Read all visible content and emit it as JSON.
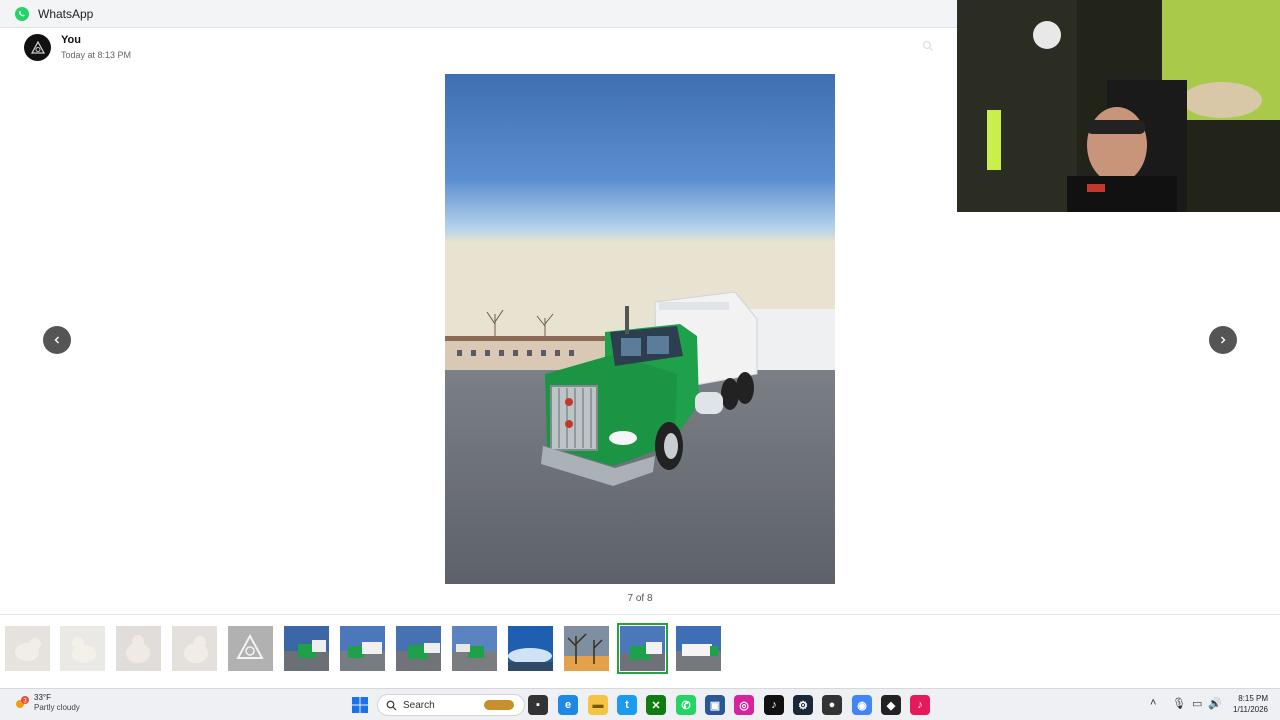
{
  "window": {
    "app_name": "WhatsApp"
  },
  "sender": {
    "name": "You",
    "timestamp": "Today at 8:13 PM"
  },
  "viewer": {
    "counter": "7 of 8",
    "prev_icon": "chevron-left-icon",
    "next_icon": "chevron-right-icon"
  },
  "thumbnails": [
    {
      "subject": "dog",
      "state": "faded"
    },
    {
      "subject": "dog",
      "state": "faded"
    },
    {
      "subject": "dog",
      "state": "faded"
    },
    {
      "subject": "dog",
      "state": "faded"
    },
    {
      "subject": "logo",
      "state": "faded"
    },
    {
      "subject": "green truck",
      "state": "normal"
    },
    {
      "subject": "green truck",
      "state": "normal"
    },
    {
      "subject": "green truck",
      "state": "normal"
    },
    {
      "subject": "green truck",
      "state": "normal"
    },
    {
      "subject": "sky",
      "state": "normal"
    },
    {
      "subject": "sunset trees",
      "state": "normal"
    },
    {
      "subject": "green truck",
      "state": "selected"
    },
    {
      "subject": "white truck",
      "state": "normal"
    }
  ],
  "taskbar": {
    "weather_badge": "3",
    "weather_temp": "33°F",
    "weather_desc": "Partly cloudy",
    "search_label": "Search",
    "time": "8:15 PM",
    "date": "1/11/2026"
  },
  "colors": {
    "accent": "#25a244",
    "truck_green": "#1fa04a",
    "sky_top": "#3f6fb0",
    "nav_bg": "#555555"
  }
}
